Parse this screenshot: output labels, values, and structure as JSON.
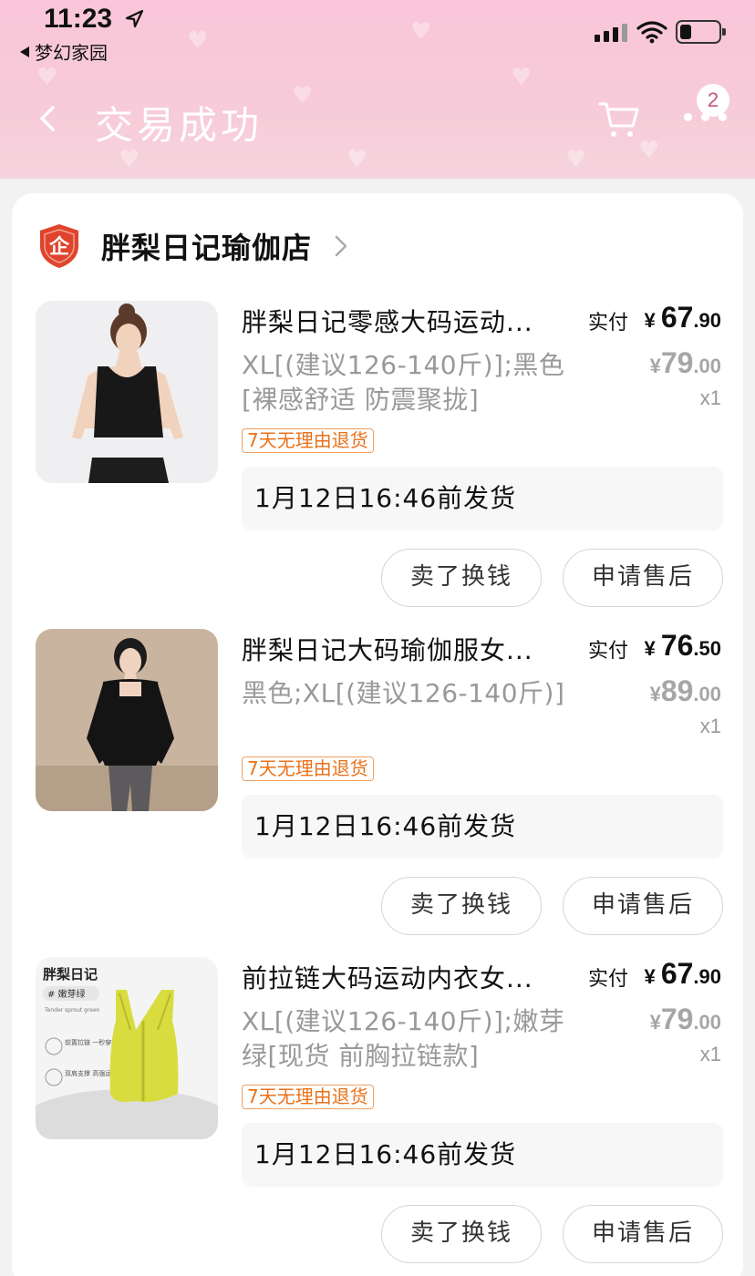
{
  "status_bar": {
    "time": "11:23",
    "back_app": "梦幻家园"
  },
  "nav": {
    "title": "交易成功",
    "cart_badge": "2"
  },
  "shop": {
    "name": "胖梨日记瑜伽店",
    "logo_char": "企"
  },
  "items": [
    {
      "title": "胖梨日记零感大码运动...",
      "spec": "XL[(建议126-140斤)];黑色[裸感舒适 防震聚拢]",
      "paid_label": "实付",
      "paid_currency": "¥",
      "paid_int": "67",
      "paid_dec": ".90",
      "orig_currency": "¥",
      "orig_int": "79",
      "orig_dec": ".00",
      "qty": "x1",
      "tag": "7天无理由退货",
      "ship": "1月12日16:46前发货",
      "sell_label": "卖了换钱",
      "aftersale_label": "申请售后"
    },
    {
      "title": "胖梨日记大码瑜伽服女...",
      "spec": "黑色;XL[(建议126-140斤)]",
      "paid_label": "实付",
      "paid_currency": "¥",
      "paid_int": "76",
      "paid_dec": ".50",
      "orig_currency": "¥",
      "orig_int": "89",
      "orig_dec": ".00",
      "qty": "x1",
      "tag": "7天无理由退货",
      "ship": "1月12日16:46前发货",
      "sell_label": "卖了换钱",
      "aftersale_label": "申请售后"
    },
    {
      "title": "前拉链大码运动内衣女...",
      "spec": "XL[(建议126-140斤)];嫩芽绿[现货 前胸拉链款]",
      "paid_label": "实付",
      "paid_currency": "¥",
      "paid_int": "67",
      "paid_dec": ".90",
      "orig_currency": "¥",
      "orig_int": "79",
      "orig_dec": ".00",
      "qty": "x1",
      "tag": "7天无理由退货",
      "ship": "1月12日16:46前发货",
      "sell_label": "卖了换钱",
      "aftersale_label": "申请售后",
      "thumb_brand": "胖梨日记",
      "thumb_color": "# 嫩芽绿",
      "thumb_en": "Tender sprout green",
      "thumb_feature1": "前置拉链 一秒穿戴",
      "thumb_feature2": "双肩支撑 高强运动"
    }
  ],
  "colors": {
    "header_pink": "#f9c6d9",
    "tag_orange": "#e8721c",
    "shop_logo_red": "#e0442c"
  }
}
